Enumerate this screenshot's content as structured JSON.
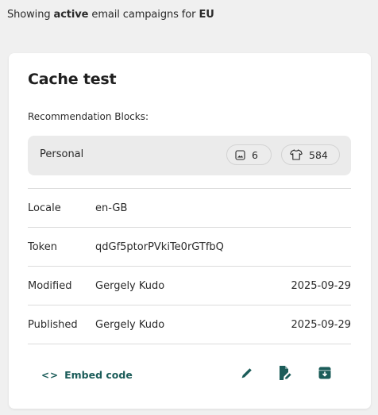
{
  "header": {
    "prefix": "Showing",
    "status": "active",
    "middle": "email campaigns for",
    "region": "EU"
  },
  "campaign": {
    "title": "Cache test",
    "rec_blocks_label": "Recommendation Blocks:",
    "blocks": [
      {
        "name": "Personal",
        "image_count": "6",
        "product_count": "584"
      }
    ],
    "details": [
      {
        "key": "Locale",
        "value": "en-GB",
        "date": ""
      },
      {
        "key": "Token",
        "value": "qdGf5ptorPVkiTe0rGTfbQ",
        "date": ""
      },
      {
        "key": "Modified",
        "value": "Gergely Kudo",
        "date": "2025-09-29"
      },
      {
        "key": "Published",
        "value": "Gergely Kudo",
        "date": "2025-09-29"
      }
    ],
    "embed": {
      "chevrons": "<>",
      "label": "Embed code"
    },
    "icons": {
      "image": "image-icon",
      "product": "shirt-icon",
      "edit": "pencil-icon",
      "edit_doc": "document-edit-icon",
      "archive": "archive-icon"
    }
  },
  "colors": {
    "accent": "#1b5c59",
    "background": "#f0f0f0",
    "card": "#ffffff",
    "block": "#ebebeb"
  }
}
